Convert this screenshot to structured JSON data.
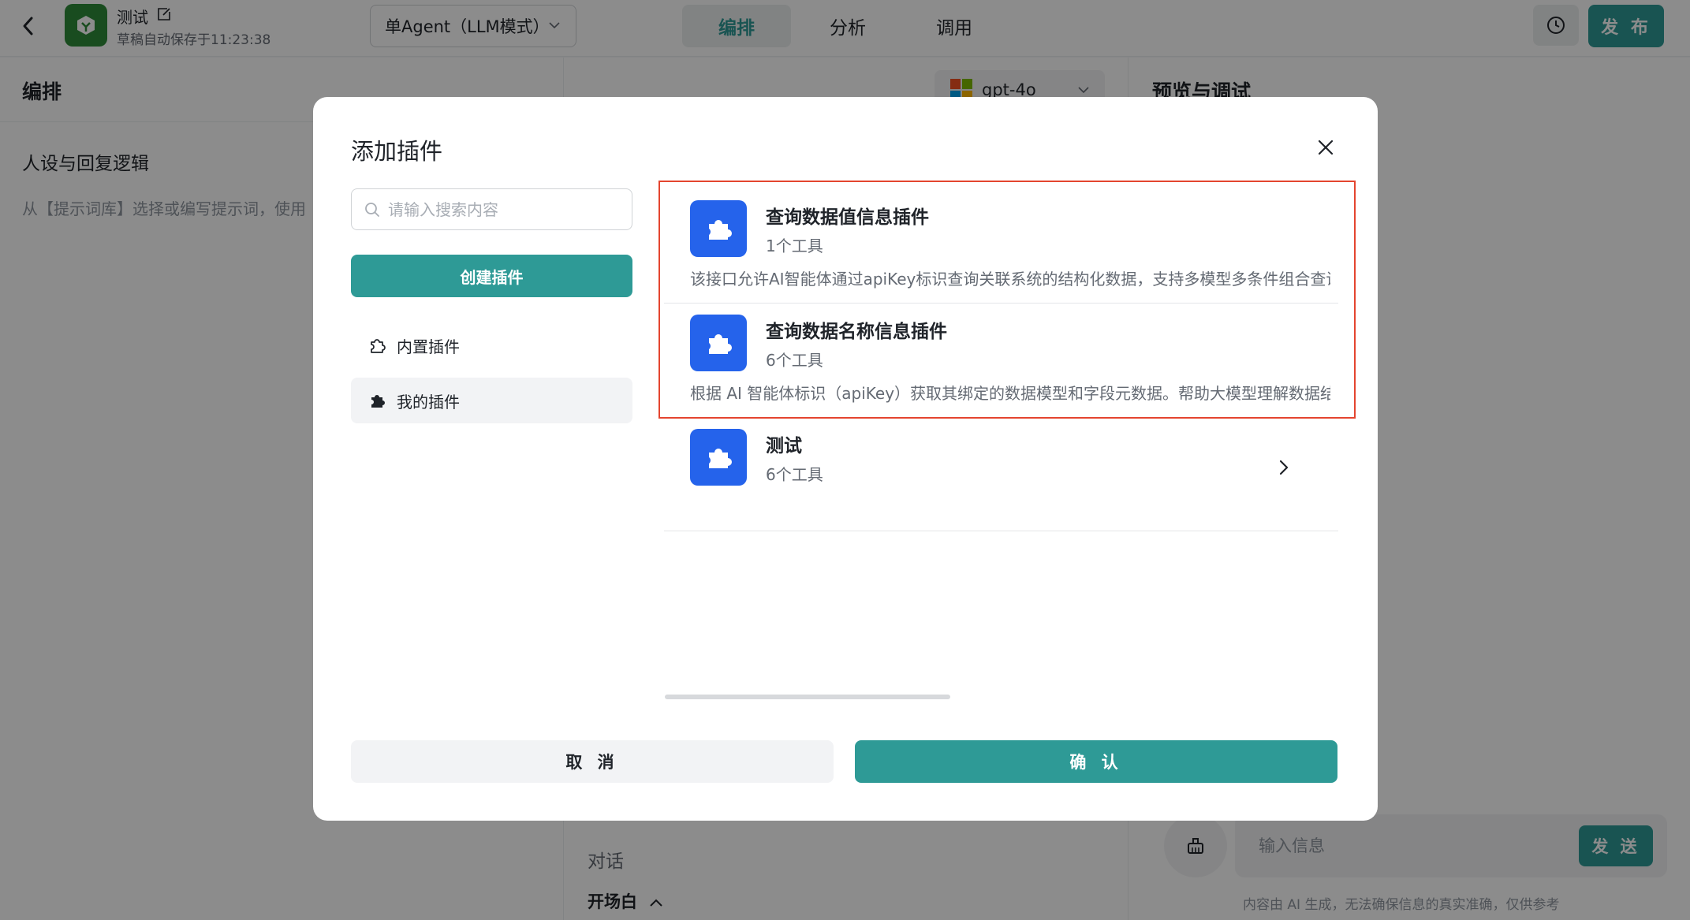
{
  "header": {
    "app_name": "测试",
    "save_status": "草稿自动保存于11:23:38",
    "mode_select": "单Agent（LLM模式）",
    "tabs": [
      {
        "label": "编排",
        "active": true
      },
      {
        "label": "分析",
        "active": false
      },
      {
        "label": "调用",
        "active": false
      }
    ],
    "publish_label": "发 布",
    "accent_color": "#2e9a96"
  },
  "left_panel": {
    "title": "编排",
    "persona_title": "人设与回复逻辑",
    "persona_hint": "从【提示词库】选择或编写提示词，使用"
  },
  "mid_panel": {
    "model": "gpt-4o",
    "dialog_label": "对话",
    "opening_label": "开场白"
  },
  "right_panel": {
    "title": "预览与调试",
    "input_placeholder": "输入信息",
    "send_label": "发 送",
    "disclaimer": "内容由 AI 生成，无法确保信息的真实准确，仅供参考"
  },
  "modal": {
    "title": "添加插件",
    "search_placeholder": "请输入搜索内容",
    "create_label": "创建插件",
    "side_items": [
      {
        "label": "内置插件",
        "icon": "puzzle-outline-icon",
        "selected": false
      },
      {
        "label": "我的插件",
        "icon": "puzzle-filled-icon",
        "selected": true
      }
    ],
    "plugins": [
      {
        "name": "查询数据值信息插件",
        "tool_count": "1个工具",
        "description": "该接口允许AI智能体通过apiKey标识查询关联系统的结构化数据，支持多模型多条件组合查询"
      },
      {
        "name": "查询数据名称信息插件",
        "tool_count": "6个工具",
        "description": "根据 AI 智能体标识（apiKey）获取其绑定的数据模型和字段元数据。帮助大模型理解数据结构"
      },
      {
        "name": "测试",
        "tool_count": "6个工具",
        "description": ""
      }
    ],
    "cancel_label": "取 消",
    "confirm_label": "确 认",
    "highlight_color": "#e4452f",
    "plugin_icon_color": "#2563eb"
  }
}
